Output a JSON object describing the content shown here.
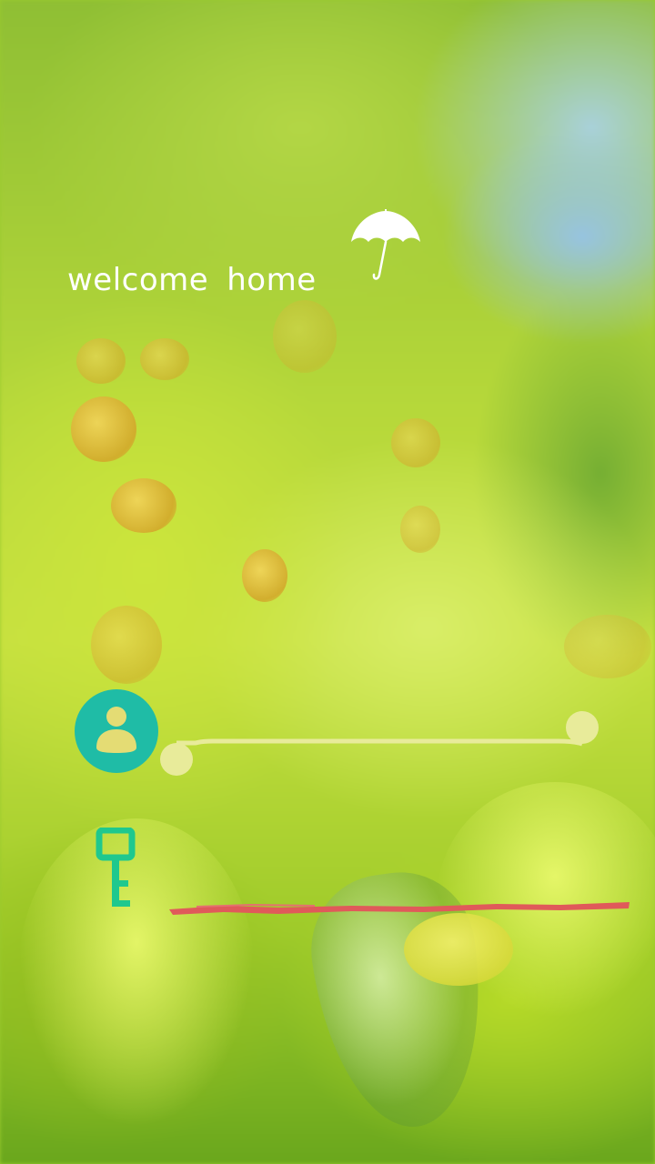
{
  "header": {
    "welcome_word": "welcome",
    "home_word": "home"
  },
  "icons": {
    "umbrella": "umbrella-icon",
    "user": "user-avatar-icon",
    "key": "key-icon"
  },
  "form": {
    "username": {
      "value": "",
      "placeholder": ""
    },
    "password": {
      "value": "",
      "placeholder": ""
    }
  },
  "colors": {
    "avatar_bg": "#1fbca6",
    "key": "#1fc88e",
    "username_line": "#e8eb9a",
    "password_line": "#e05a5a",
    "text": "#ffffff"
  }
}
